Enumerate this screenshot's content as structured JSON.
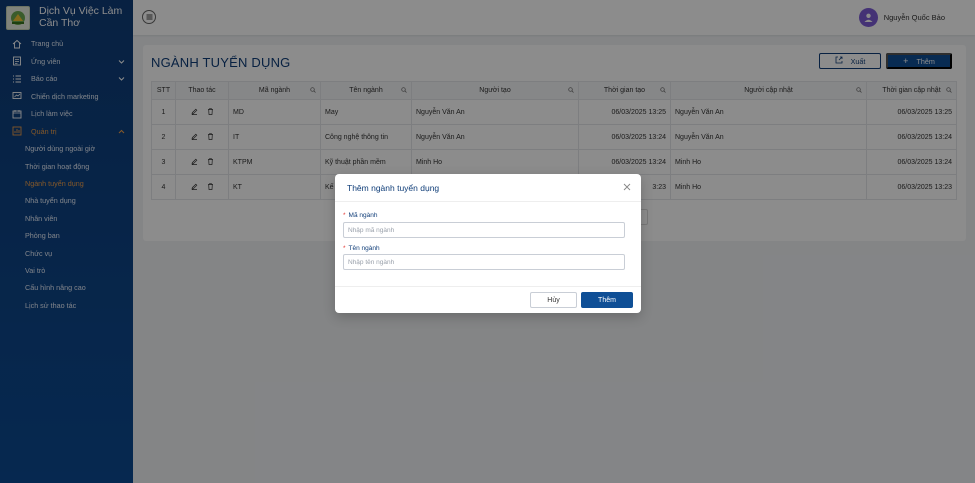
{
  "brand": {
    "line1": "Dịch Vụ Việc Làm",
    "line2": "Cần Thơ"
  },
  "sidebar": {
    "items": [
      {
        "label": "Trang chủ",
        "icon": "home-icon"
      },
      {
        "label": "Ứng viên",
        "icon": "candidate-icon"
      },
      {
        "label": "Báo cáo",
        "icon": "report-icon"
      },
      {
        "label": "Chiến dịch marketing",
        "icon": "campaign-icon"
      },
      {
        "label": "Lịch làm việc",
        "icon": "calendar-icon"
      },
      {
        "label": "Quản trị",
        "icon": "admin-icon"
      }
    ],
    "sub_items": [
      "Người dùng ngoài giờ",
      "Thời gian hoạt động",
      "Ngành tuyển dụng",
      "Nhà tuyển dụng",
      "Nhân viên",
      "Phòng ban",
      "Chức vụ",
      "Vai trò",
      "Cấu hình nâng cao",
      "Lịch sử thao tác"
    ],
    "active_sub": "Ngành tuyển dụng"
  },
  "topbar": {
    "user_name": "Nguyễn Quốc Bảo"
  },
  "page": {
    "title": "NGÀNH TUYỂN DỤNG",
    "export_label": "Xuất",
    "add_label": "Thêm"
  },
  "table": {
    "headers": [
      "STT",
      "Thao tác",
      "Mã ngành",
      "Tên ngành",
      "Người tạo",
      "Thời gian tạo",
      "Người cập nhật",
      "Thời gian cập nhật"
    ],
    "rows": [
      {
        "stt": "1",
        "code": "MD",
        "name": "May",
        "creator": "Nguyễn Văn An",
        "created": "06/03/2025 13:25",
        "updater": "Nguyễn Văn An",
        "updated": "06/03/2025 13:25"
      },
      {
        "stt": "2",
        "code": "IT",
        "name": "Công nghệ thông tin",
        "creator": "Nguyễn Văn An",
        "created": "06/03/2025 13:24",
        "updater": "Nguyễn Văn An",
        "updated": "06/03/2025 13:24"
      },
      {
        "stt": "3",
        "code": "KTPM",
        "name": "Kỹ thuật phần mềm",
        "creator": "Minh Ho",
        "created": "06/03/2025 13:24",
        "updater": "Minh Ho",
        "updated": "06/03/2025 13:24"
      },
      {
        "stt": "4",
        "code": "KT",
        "name": "Kế",
        "creator": "",
        "created": "3:23",
        "updater": "Minh Ho",
        "updated": "06/03/2025 13:23"
      }
    ]
  },
  "modal": {
    "title": "Thêm ngành tuyển dụng",
    "code_label": "Mã ngành",
    "code_placeholder": "Nhập mã ngành",
    "name_label": "Tên ngành",
    "name_placeholder": "Nhập tên ngành",
    "cancel_label": "Hủy",
    "ok_label": "Thêm"
  },
  "colors": {
    "primary": "#0f4f96",
    "sidebar": "#0f3d78",
    "active": "#f0a04b"
  }
}
